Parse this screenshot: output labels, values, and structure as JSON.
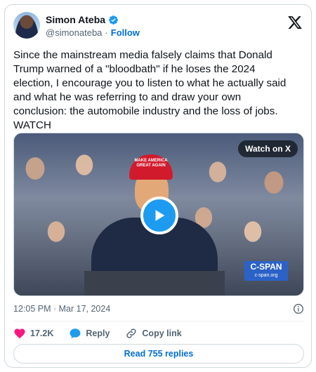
{
  "author": {
    "name": "Simon Ateba",
    "handle": "@simonateba",
    "separator": "·",
    "follow_label": "Follow"
  },
  "tweet": {
    "text": "Since the mainstream media falsely claims that Donald\nTrump warned of a \"bloodbath\" if he loses the 2024\nelection, I encourage you to listen to what he actually said\nand what he was referring to and draw your own\nconclusion: the automobile industry and the loss of jobs.\nWATCH"
  },
  "media": {
    "watch_label": "Watch on X",
    "hat_text": "MAKE AMERICA GREAT AGAIN",
    "cspan_label": "C-SPAN",
    "cspan_url": "c-span.org"
  },
  "meta": {
    "timestamp": "12:05 PM · Mar 17, 2024"
  },
  "actions": {
    "like_count": "17.2K",
    "reply_label": "Reply",
    "copy_link_label": "Copy link"
  },
  "replies_button": "Read 755 replies",
  "colors": {
    "brand_blue": "#1d9bf0",
    "link_blue": "#006fd6",
    "like_red": "#f91880",
    "muted": "#536471"
  }
}
